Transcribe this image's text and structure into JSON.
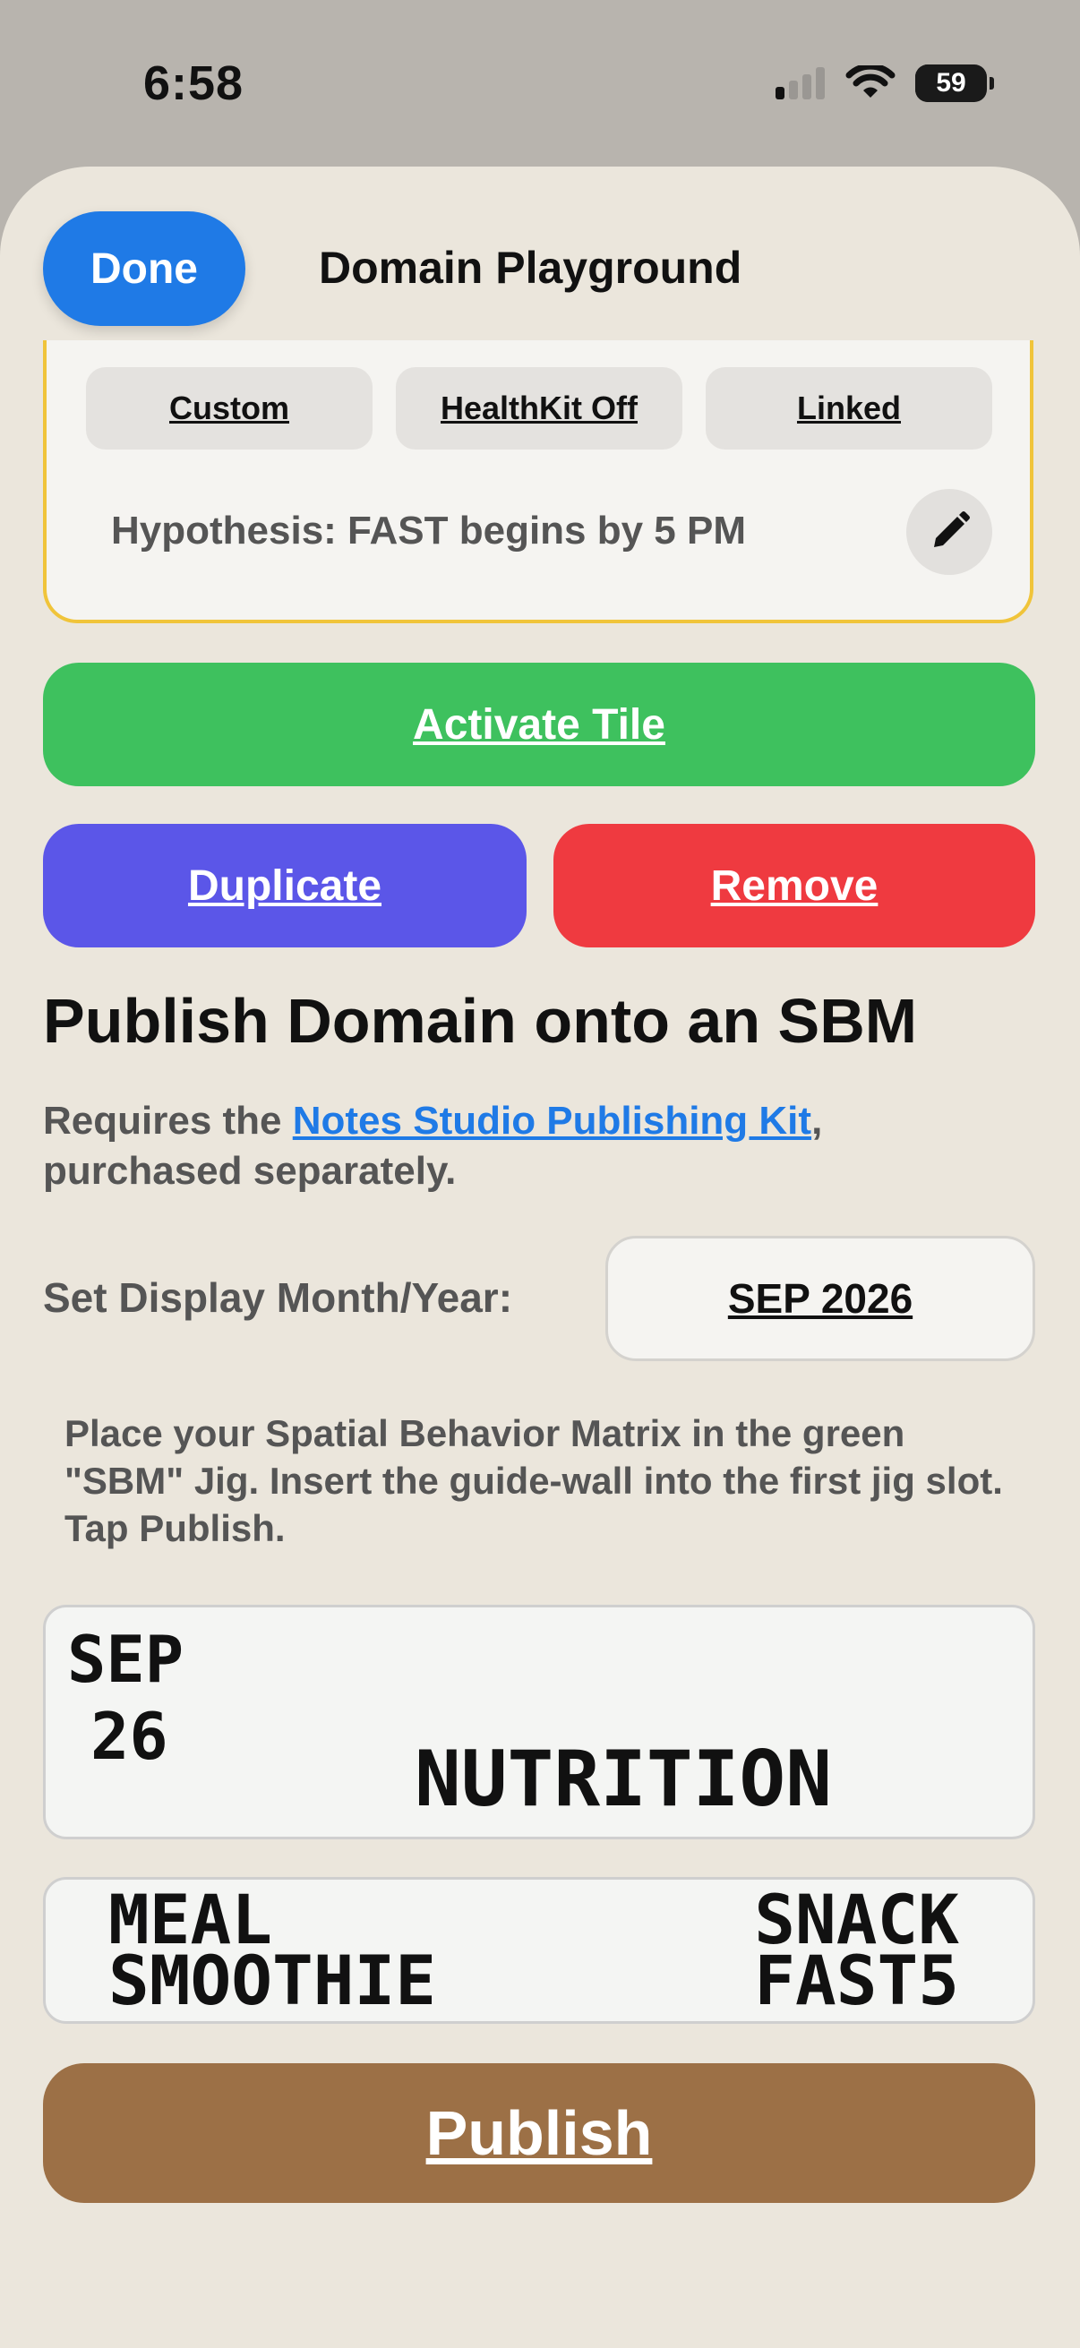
{
  "status": {
    "time": "6:58",
    "battery_level": "59",
    "icons": [
      "cellular-signal-icon",
      "wifi-icon",
      "battery-icon"
    ]
  },
  "header": {
    "done_label": "Done",
    "title": "Domain Playground"
  },
  "tile_card": {
    "chips": [
      "Custom",
      "HealthKit Off",
      "Linked"
    ],
    "hypothesis": "Hypothesis: FAST begins by 5 PM",
    "border_color": "#f0c43a"
  },
  "actions": {
    "activate_label": "Activate Tile",
    "duplicate_label": "Duplicate",
    "remove_label": "Remove"
  },
  "publish_section": {
    "heading": "Publish Domain onto an SBM",
    "requires_prefix": "Requires the ",
    "kit_link": "Notes Studio Publishing Kit",
    "requires_suffix": ", purchased separately.",
    "month_label": "Set Display Month/Year:",
    "month_value": "SEP 2026",
    "instructions": "Place your Spatial Behavior Matrix in the green \"SBM\" Jig. Insert the guide-wall into the first jig slot. Tap Publish.",
    "preview_month": "SEP",
    "preview_year": "26",
    "preview_domain": "NUTRITION",
    "preview_left_1": "MEAL",
    "preview_left_2": "SMOOTHIE",
    "preview_right_1": "SNACK",
    "preview_right_2": "FAST5",
    "publish_label": "Publish"
  },
  "colors": {
    "primary_blue": "#1f7ae6",
    "activate_green": "#3ec15e",
    "duplicate_purple": "#5b56e8",
    "remove_red": "#ef3a40",
    "publish_brown": "#9c7046",
    "sheet_bg": "#ebe6dc"
  }
}
